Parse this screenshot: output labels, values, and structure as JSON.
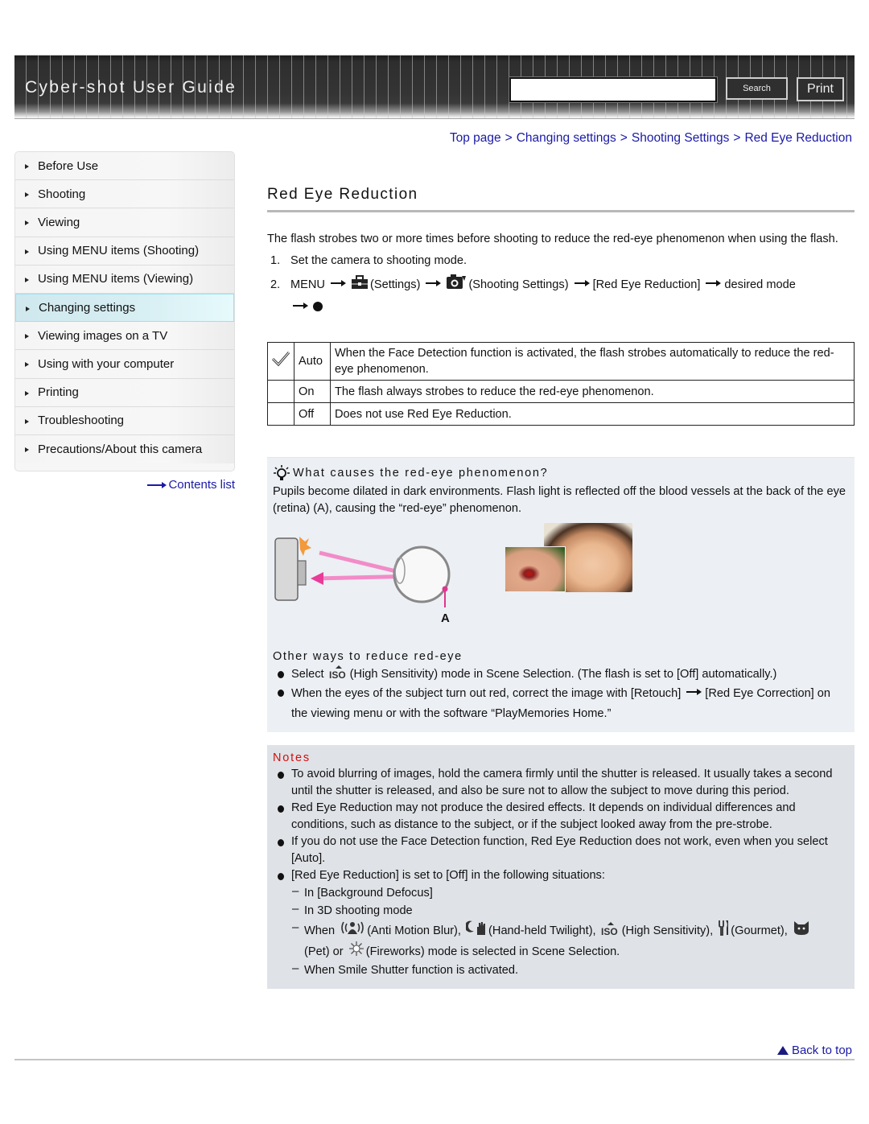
{
  "header": {
    "title": "Cyber-shot User Guide",
    "search_placeholder": "",
    "search_button": "Search",
    "print_button": "Print"
  },
  "breadcrumb": [
    {
      "label": "Top page"
    },
    {
      "label": "Changing settings"
    },
    {
      "label": "Shooting Settings"
    },
    {
      "label": "Red Eye Reduction"
    }
  ],
  "breadcrumb_separator": ">",
  "sidebar": {
    "items": [
      {
        "label": "Before Use",
        "active": false
      },
      {
        "label": "Shooting",
        "active": false
      },
      {
        "label": "Viewing",
        "active": false
      },
      {
        "label": "Using MENU items (Shooting)",
        "active": false
      },
      {
        "label": "Using MENU items (Viewing)",
        "active": false
      },
      {
        "label": "Changing settings",
        "active": true
      },
      {
        "label": "Viewing images on a TV",
        "active": false
      },
      {
        "label": "Using with your computer",
        "active": false
      },
      {
        "label": "Printing",
        "active": false
      },
      {
        "label": "Troubleshooting",
        "active": false
      },
      {
        "label": "Precautions/About this camera",
        "active": false
      }
    ],
    "contents_link": "Contents list"
  },
  "main": {
    "title": "Red Eye Reduction",
    "intro": "The flash strobes two or more times before shooting to reduce the red-eye phenomenon when using the flash.",
    "steps": {
      "step1_num": "1.",
      "step1_text": "Set the camera to shooting mode.",
      "step2_num": "2.",
      "menu": "MENU",
      "settings": "(Settings)",
      "shooting_settings": "(Shooting Settings)",
      "red_eye": "[Red Eye Reduction]",
      "desired": "desired mode"
    },
    "modes": [
      {
        "name": "Auto",
        "default": true,
        "icon": "checkmark-icon",
        "desc": "When the Face Detection function is activated, the flash strobes automatically to reduce the red-eye phenomenon."
      },
      {
        "name": "On",
        "default": false,
        "desc": "The flash always strobes to reduce the red-eye phenomenon."
      },
      {
        "name": "Off",
        "default": false,
        "desc": "Does not use Red Eye Reduction."
      }
    ],
    "hint": {
      "icon": "lightbulb-hint-icon",
      "title": "What causes the red-eye phenomenon?",
      "text": "Pupils become dilated in dark environments. Flash light is reflected off the blood vessels at the back of the eye (retina) (A), causing the “red-eye” phenomenon.",
      "figure_label": "A",
      "other_title": "Other ways to reduce red-eye",
      "other_1_pre": "Select",
      "other_1_post": "(High Sensitivity) mode in Scene Selection. (The flash is set to [Off] automatically.)",
      "other_2_pre": "When the eyes of the subject turn out red, correct the image with [Retouch]",
      "other_2_post": "[Red Eye Correction] on the viewing menu or with the software “PlayMemories Home.”"
    },
    "notes": {
      "title": "Notes",
      "items": [
        "To avoid blurring of images, hold the camera firmly until the shutter is released. It usually takes a second until the shutter is released, and also be sure not to allow the subject to move during this period.",
        "Red Eye Reduction may not produce the desired effects. It depends on individual differences and conditions, such as distance to the subject, or if the subject looked away from the pre-strobe.",
        "If you do not use the Face Detection function, Red Eye Reduction does not work, even when you select [Auto].",
        "[Red Eye Reduction] is set to [Off] in the following situations:"
      ],
      "sub_items": {
        "s1": "In [Background Defocus]",
        "s2": "In 3D shooting mode",
        "s3_when": "When",
        "s3_anti": "(Anti Motion Blur),",
        "s3_twilight": "(Hand-held Twilight),",
        "s3_iso": "(High Sensitivity),",
        "s3_gourmet": "(Gourmet),",
        "s3_pet": "(Pet) or",
        "s3_fireworks": "(Fireworks) mode is selected in Scene Selection.",
        "s4": "When Smile Shutter function is activated."
      }
    }
  },
  "footer": {
    "back_to_top": "Back to top"
  }
}
